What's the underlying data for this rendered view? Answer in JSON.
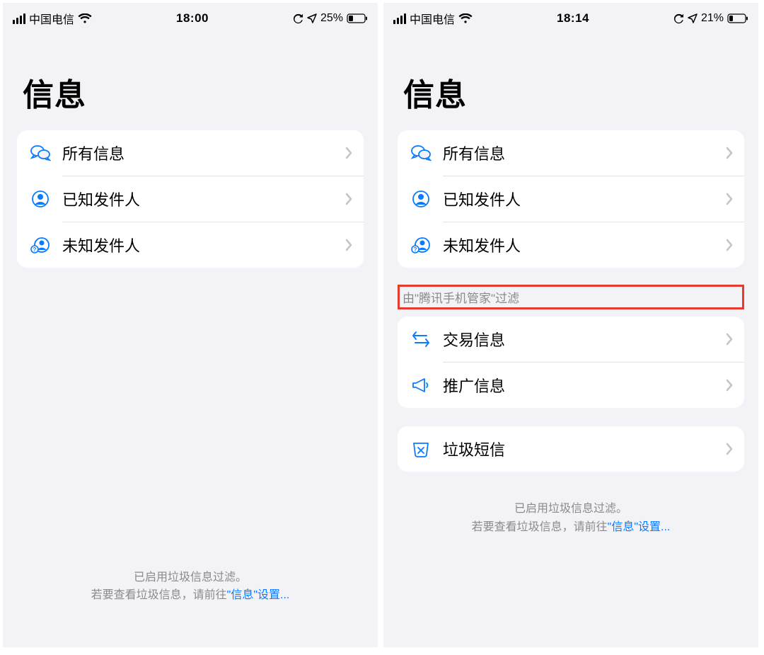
{
  "left": {
    "status": {
      "carrier": "中国电信",
      "time": "18:00",
      "battery_pct": "25%"
    },
    "title": "信息",
    "rows": [
      {
        "label": "所有信息"
      },
      {
        "label": "已知发件人"
      },
      {
        "label": "未知发件人"
      }
    ],
    "footer": {
      "line1": "已启用垃圾信息过滤。",
      "line2_pre": "若要查看垃圾信息，请前往",
      "line2_link": "\"信息\"设置..."
    }
  },
  "right": {
    "status": {
      "carrier": "中国电信",
      "time": "18:14",
      "battery_pct": "21%"
    },
    "title": "信息",
    "rows": [
      {
        "label": "所有信息"
      },
      {
        "label": "已知发件人"
      },
      {
        "label": "未知发件人"
      }
    ],
    "filter_header": "由\"腾讯手机管家\"过滤",
    "filter_rows": [
      {
        "label": "交易信息"
      },
      {
        "label": "推广信息"
      }
    ],
    "junk_row": {
      "label": "垃圾短信"
    },
    "footer": {
      "line1": "已启用垃圾信息过滤。",
      "line2_pre": "若要查看垃圾信息，请前往",
      "line2_link": "\"信息\"设置..."
    }
  },
  "colors": {
    "accent": "#0a7aff",
    "muted": "#8a8a8e",
    "chevron": "#c5c5c8",
    "highlight_border": "#e33b2e"
  }
}
